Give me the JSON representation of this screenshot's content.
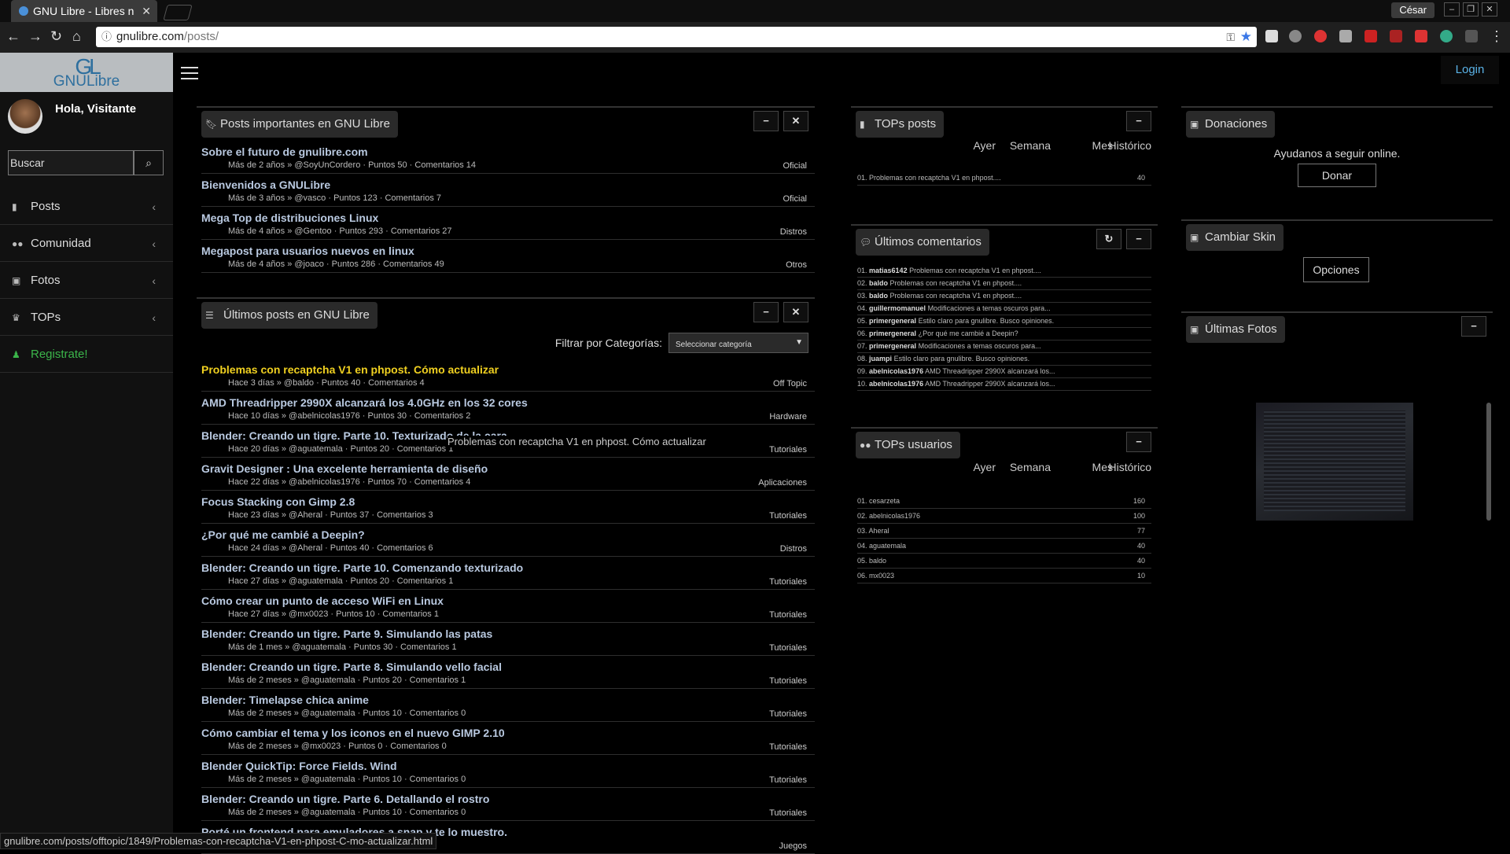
{
  "browser": {
    "tab_title": "GNU Libre - Libres n",
    "user_name": "César",
    "url_domain": "gnulibre.com",
    "url_path": "/posts/"
  },
  "site": {
    "logo_line1": "GL",
    "logo_line2": "GNULibre",
    "greeting": "Hola, Visitante",
    "search_placeholder": "Buscar",
    "login": "Login",
    "menu": [
      {
        "label": "Posts",
        "icon": "file-icon"
      },
      {
        "label": "Comunidad",
        "icon": "users-icon"
      },
      {
        "label": "Fotos",
        "icon": "image-icon"
      },
      {
        "label": "TOPs",
        "icon": "trophy-icon"
      },
      {
        "label": "Registrate!",
        "icon": "person-icon"
      }
    ]
  },
  "important": {
    "title": "Posts importantes en GNU Libre",
    "posts": [
      {
        "title": "Sobre el futuro de gnulibre.com",
        "meta": "Más de 2 años » @SoyUnCordero · Puntos 50 · Comentarios 14",
        "cat": "Oficial"
      },
      {
        "title": "Bienvenidos a GNULibre",
        "meta": "Más de 3 años » @vasco · Puntos 123 · Comentarios 7",
        "cat": "Oficial"
      },
      {
        "title": "Mega Top de distribuciones Linux",
        "meta": "Más de 4 años » @Gentoo · Puntos 293 · Comentarios 27",
        "cat": "Distros"
      },
      {
        "title": "Megapost para usuarios nuevos en linux",
        "meta": "Más de 4 años » @joaco · Puntos 286 · Comentarios 49",
        "cat": "Otros"
      }
    ]
  },
  "latest": {
    "title": "Últimos posts en GNU Libre",
    "filter_label": "Filtrar por Categorías:",
    "filter_value": "Seleccionar categoría",
    "tooltip": "Problemas con recaptcha V1 en phpost. Cómo actualizar",
    "posts": [
      {
        "title": "Problemas con recaptcha V1 en phpost. Cómo actualizar",
        "meta": "Hace 3 días » @baldo · Puntos 40 · Comentarios 4",
        "cat": "Off Topic"
      },
      {
        "title": "AMD Threadripper 2990X alcanzará los 4.0GHz en los 32 cores",
        "meta": "Hace 10 días » @abelnicolas1976 · Puntos 30 · Comentarios 2",
        "cat": "Hardware"
      },
      {
        "title": "Blender: Creando un tigre. Parte 10. Texturizado de la cara",
        "meta": "Hace 20 días » @aguatemala · Puntos 20 · Comentarios 1",
        "cat": "Tutoriales"
      },
      {
        "title": "Gravit Designer : Una excelente herramienta de diseño",
        "meta": "Hace 22 días » @abelnicolas1976 · Puntos 70 · Comentarios 4",
        "cat": "Aplicaciones"
      },
      {
        "title": "Focus Stacking con Gimp 2.8",
        "meta": "Hace 23 días » @Aheral · Puntos 37 · Comentarios 3",
        "cat": "Tutoriales"
      },
      {
        "title": "¿Por qué me cambié a Deepin?",
        "meta": "Hace 24 días » @Aheral · Puntos 40 · Comentarios 6",
        "cat": "Distros"
      },
      {
        "title": "Blender: Creando un tigre. Parte 10. Comenzando texturizado",
        "meta": "Hace 27 días » @aguatemala · Puntos 20 · Comentarios 1",
        "cat": "Tutoriales"
      },
      {
        "title": "Cómo crear un punto de acceso WiFi en Linux",
        "meta": "Hace 27 días » @mx0023 · Puntos 10 · Comentarios 1",
        "cat": "Tutoriales"
      },
      {
        "title": "Blender: Creando un tigre. Parte 9. Simulando las patas",
        "meta": "Más de 1 mes » @aguatemala · Puntos 30 · Comentarios 1",
        "cat": "Tutoriales"
      },
      {
        "title": "Blender: Creando un tigre. Parte 8. Simulando vello facial",
        "meta": "Más de 2 meses » @aguatemala · Puntos 20 · Comentarios 1",
        "cat": "Tutoriales"
      },
      {
        "title": "Blender: Timelapse chica anime",
        "meta": "Más de 2 meses » @aguatemala · Puntos 10 · Comentarios 0",
        "cat": "Tutoriales"
      },
      {
        "title": "Cómo cambiar el tema y los iconos en el nuevo GIMP 2.10",
        "meta": "Más de 2 meses » @mx0023 · Puntos 0 · Comentarios 0",
        "cat": "Tutoriales"
      },
      {
        "title": "Blender QuickTip: Force Fields. Wind",
        "meta": "Más de 2 meses » @aguatemala · Puntos 10 · Comentarios 0",
        "cat": "Tutoriales"
      },
      {
        "title": "Blender: Creando un tigre. Parte 6. Detallando el rostro",
        "meta": "Más de 2 meses » @aguatemala · Puntos 10 · Comentarios 0",
        "cat": "Tutoriales"
      },
      {
        "title": "Porté un frontend para emuladores a snap y te lo muestro.",
        "meta": "",
        "cat": "Juegos"
      }
    ]
  },
  "periods": [
    "Ayer",
    "Semana",
    "Mes",
    "Histórico"
  ],
  "tops_posts": {
    "title": "TOPs posts",
    "rows": [
      {
        "label": "01. Problemas con recaptcha V1 en phpost....",
        "value": "40"
      }
    ]
  },
  "comments": {
    "title": "Últimos comentarios",
    "rows": [
      {
        "n": "01.",
        "user": "matias6142",
        "text": "Problemas con recaptcha V1 en phpost...."
      },
      {
        "n": "02.",
        "user": "baldo",
        "text": "Problemas con recaptcha V1 en phpost...."
      },
      {
        "n": "03.",
        "user": "baldo",
        "text": "Problemas con recaptcha V1 en phpost...."
      },
      {
        "n": "04.",
        "user": "guillermomanuel",
        "text": "Modificaciones a temas oscuros para..."
      },
      {
        "n": "05.",
        "user": "primergeneral",
        "text": "Estilo claro para gnulibre. Busco opiniones."
      },
      {
        "n": "06.",
        "user": "primergeneral",
        "text": "¿Por qué me cambié a Deepin?"
      },
      {
        "n": "07.",
        "user": "primergeneral",
        "text": "Modificaciones a temas oscuros para..."
      },
      {
        "n": "08.",
        "user": "juampi",
        "text": "Estilo claro para gnulibre. Busco opiniones."
      },
      {
        "n": "09.",
        "user": "abelnicolas1976",
        "text": "AMD Threadripper 2990X alcanzará los..."
      },
      {
        "n": "10.",
        "user": "abelnicolas1976",
        "text": "AMD Threadripper 2990X alcanzará los..."
      }
    ]
  },
  "tops_users": {
    "title": "TOPs usuarios",
    "rows": [
      {
        "label": "01. cesarzeta",
        "value": "160"
      },
      {
        "label": "02. abelnicolas1976",
        "value": "100"
      },
      {
        "label": "03. Aheral",
        "value": "77"
      },
      {
        "label": "04. aguatemala",
        "value": "40"
      },
      {
        "label": "05. baldo",
        "value": "40"
      },
      {
        "label": "06. mx0023",
        "value": "10"
      }
    ]
  },
  "donations": {
    "title": "Donaciones",
    "text": "Ayudanos a seguir online.",
    "button": "Donar"
  },
  "skin": {
    "title": "Cambiar Skin",
    "button": "Opciones"
  },
  "photos": {
    "title": "Últimas Fotos"
  },
  "statusbar": "gnulibre.com/posts/offtopic/1849/Problemas-con-recaptcha-V1-en-phpost-C-mo-actualizar.html",
  "colors": {
    "link": "#b9c9e0",
    "hover_link": "#f0d020",
    "login": "#5ab3e8",
    "register": "#3bb54a"
  }
}
